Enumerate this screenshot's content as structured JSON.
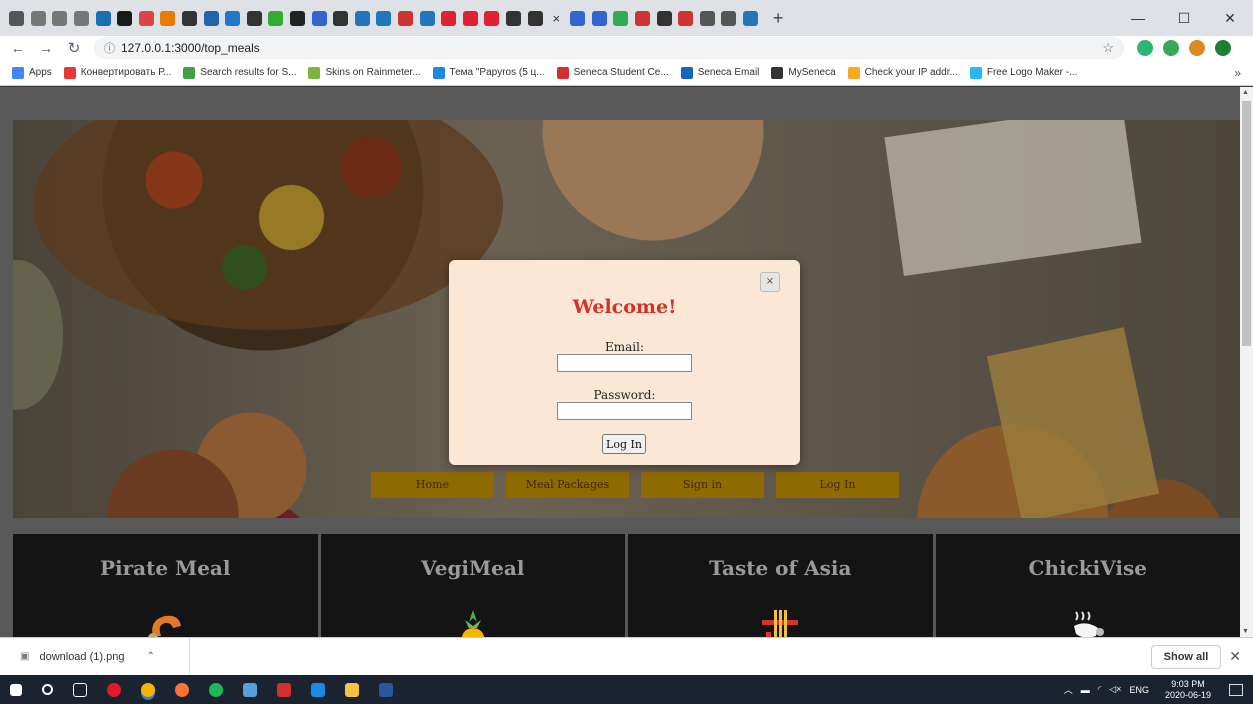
{
  "browser": {
    "url": "127.0.0.1:3000/top_meals",
    "tab_count": 34,
    "tab_colors": [
      "#555",
      "#777",
      "#777",
      "#777",
      "#1a6fb0",
      "#1a1a1a",
      "#d44",
      "#e67c00",
      "#333",
      "#26a",
      "#27c",
      "#333",
      "#3a3",
      "#222",
      "#36c",
      "#333",
      "#27b",
      "#27b",
      "#c33",
      "#27b",
      "#d23",
      "#d23",
      "#d23",
      "#333",
      "#333",
      "#36c",
      "#36c",
      "#3a5",
      "#c33",
      "#333",
      "#c33",
      "#555",
      "#555",
      "#27b",
      "#3a5",
      "#3a5",
      "#36c",
      "#333",
      "#555",
      "#27b",
      "#3a5",
      "#222",
      "#e53",
      "#36c",
      "#3a5",
      "#555",
      "#3a5",
      "#27b"
    ],
    "active_tab_close": "×",
    "new_tab": "+",
    "window_controls": [
      "—",
      "☐",
      "✕"
    ]
  },
  "bookmarks": [
    {
      "label": "Apps",
      "color": "#4285f4"
    },
    {
      "label": "Конвертировать Р...",
      "color": "#e53935"
    },
    {
      "label": "Search results for S...",
      "color": "#43a047"
    },
    {
      "label": "Skins on Rainmeter...",
      "color": "#7cb342"
    },
    {
      "label": "Тема \"Papyros (5 ц...",
      "color": "#1e88e5"
    },
    {
      "label": "Seneca Student Ce...",
      "color": "#d32f2f"
    },
    {
      "label": "Seneca Email",
      "color": "#1565c0"
    },
    {
      "label": "MySeneca",
      "color": "#333333"
    },
    {
      "label": "Check your IP addr...",
      "color": "#f9a825"
    },
    {
      "label": "Free Logo Maker -...",
      "color": "#29b6f6"
    }
  ],
  "nav": {
    "home": "Home",
    "meal_packages": "Meal Packages",
    "sign_in": "Sign in",
    "log_in": "Log In"
  },
  "cards": [
    {
      "title": "Pirate Meal",
      "icon": "shrimp-icon"
    },
    {
      "title": "VegiMeal",
      "icon": "pineapple-icon"
    },
    {
      "title": "Taste of Asia",
      "icon": "noodles-icon"
    },
    {
      "title": "ChickiVise",
      "icon": "steaming-chicken-icon"
    }
  ],
  "modal": {
    "close": "×",
    "welcome": "Welcome!",
    "email_label": "Email:",
    "email_value": "",
    "password_label": "Password:",
    "password_value": "",
    "submit": "Log In"
  },
  "downloads": {
    "file": "download (1).png",
    "show_all": "Show all",
    "close": "✕"
  },
  "taskbar": {
    "language": "ENG",
    "time": "9:03 PM",
    "date": "2020-06-19"
  },
  "colors": {
    "accent_welcome": "#d2322a",
    "nav_button": "#8f6a00",
    "modal_bg": "#fbe7d6"
  }
}
